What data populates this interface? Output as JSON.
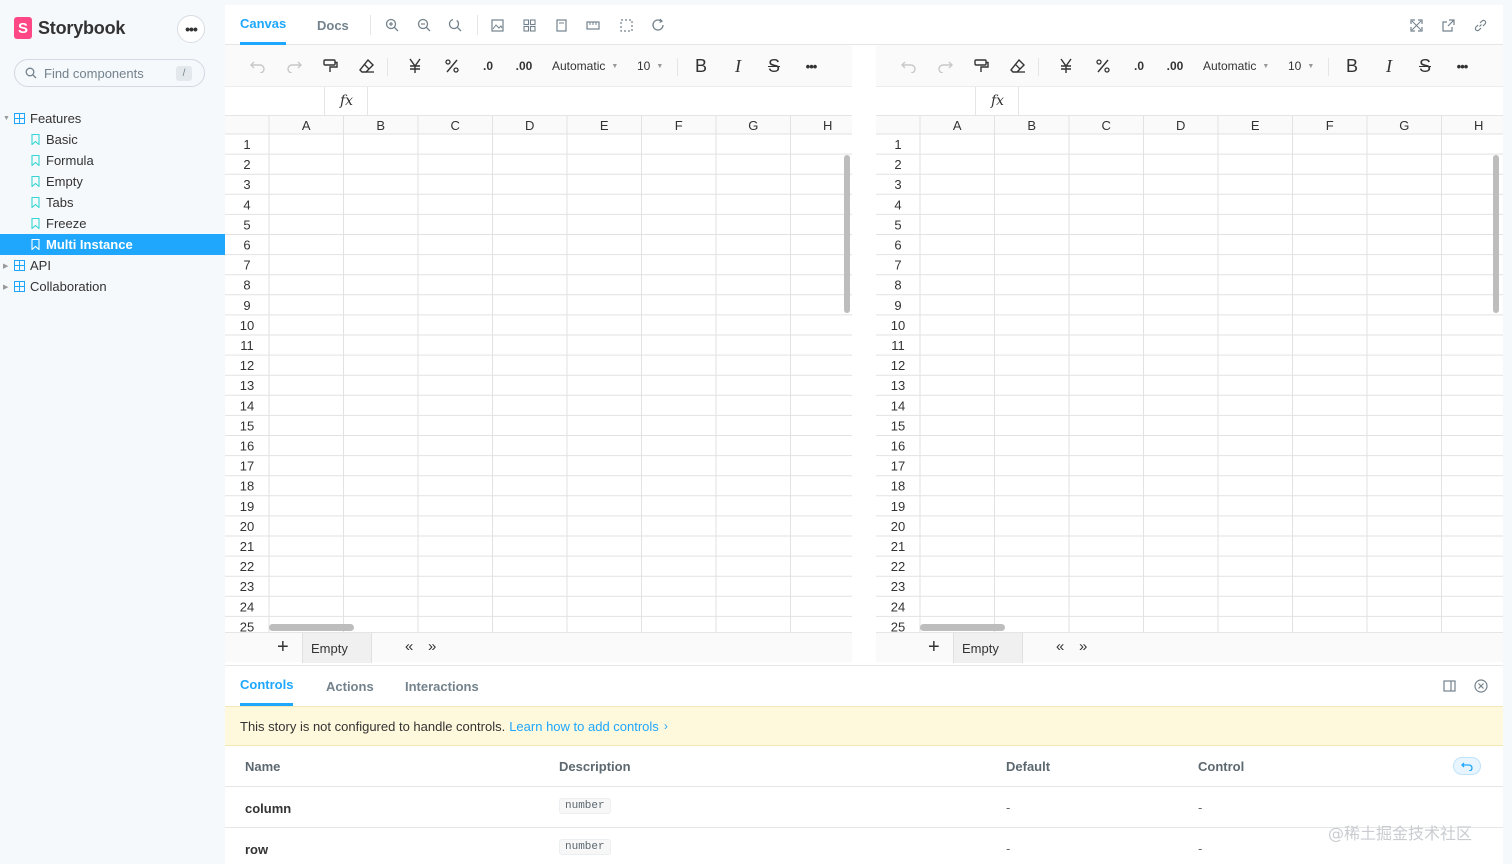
{
  "brand": {
    "name": "Storybook",
    "logo_letter": "S",
    "accent": "#ff4785"
  },
  "sidebar": {
    "more_label": "•••",
    "search": {
      "placeholder": "Find components",
      "shortcut": "/"
    },
    "tree": [
      {
        "type": "group",
        "label": "Features",
        "expanded": true,
        "icon": "component-icon"
      },
      {
        "type": "story",
        "label": "Basic",
        "icon": "bookmark-icon"
      },
      {
        "type": "story",
        "label": "Formula",
        "icon": "bookmark-icon"
      },
      {
        "type": "story",
        "label": "Empty",
        "icon": "bookmark-icon"
      },
      {
        "type": "story",
        "label": "Tabs",
        "icon": "bookmark-icon"
      },
      {
        "type": "story",
        "label": "Freeze",
        "icon": "bookmark-icon"
      },
      {
        "type": "story",
        "label": "Multi Instance",
        "icon": "bookmark-icon",
        "selected": true
      },
      {
        "type": "group",
        "label": "API",
        "expanded": false,
        "icon": "component-icon"
      },
      {
        "type": "group",
        "label": "Collaboration",
        "expanded": false,
        "icon": "component-icon"
      }
    ],
    "selected_color": "#1ea7fd"
  },
  "topbar": {
    "tabs": [
      {
        "label": "Canvas",
        "active": true
      },
      {
        "label": "Docs",
        "active": false
      }
    ],
    "icons": [
      "zoom-in-icon",
      "zoom-out-icon",
      "zoom-reset-icon",
      "background-icon",
      "grid-icon",
      "viewport-icon",
      "measure-icon",
      "outline-icon",
      "remount-icon",
      "fullscreen-icon",
      "open-new-tab-icon",
      "copy-link-icon"
    ]
  },
  "spreadsheet": {
    "toolbar": {
      "number_format": "Automatic",
      "font_size": "10",
      "decrease_decimal": ".0",
      "increase_decimal": ".00",
      "bold": "B",
      "italic": "I",
      "strike": "S",
      "more": "•••"
    },
    "formula_label": "fx",
    "columns": [
      "A",
      "B",
      "C",
      "D",
      "E",
      "F",
      "G",
      "H"
    ],
    "rows": [
      "1",
      "2",
      "3",
      "4",
      "5",
      "6",
      "7",
      "8",
      "9",
      "10",
      "11",
      "12",
      "13",
      "14",
      "15",
      "16",
      "17",
      "18",
      "19",
      "20",
      "21",
      "22",
      "23",
      "24",
      "25"
    ],
    "sheet_tab": "Empty",
    "add_sheet": "+",
    "nav_prev": "«",
    "nav_next": "»"
  },
  "addons": {
    "tabs": [
      {
        "label": "Controls",
        "active": true
      },
      {
        "label": "Actions",
        "active": false
      },
      {
        "label": "Interactions",
        "active": false
      }
    ],
    "notice": {
      "text": "This story is not configured to handle controls.",
      "link": "Learn how to add controls",
      "link_arrow": "›"
    },
    "table": {
      "headers": {
        "name": "Name",
        "description": "Description",
        "default": "Default",
        "control": "Control"
      },
      "rows": [
        {
          "name": "column",
          "type": "number",
          "default": "-",
          "control": "-"
        },
        {
          "name": "row",
          "type": "number",
          "default": "-",
          "control": "-"
        }
      ]
    }
  },
  "watermark": "@稀土掘金技术社区"
}
